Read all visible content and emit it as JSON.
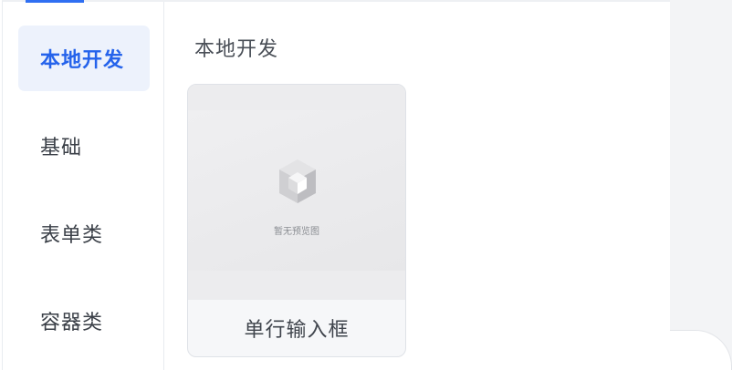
{
  "sidebar": {
    "items": [
      {
        "label": "本地开发",
        "active": true
      },
      {
        "label": "基础",
        "active": false
      },
      {
        "label": "表单类",
        "active": false
      },
      {
        "label": "容器类",
        "active": false
      }
    ]
  },
  "main": {
    "section_title": "本地开发",
    "cards": [
      {
        "name": "单行输入框",
        "preview_text": "暂无预览图",
        "preview_icon": "empty-box-icon"
      }
    ]
  },
  "colors": {
    "accent": "#2f6ff2",
    "active_text": "#2563eb",
    "active_bg": "#edf2fc"
  }
}
